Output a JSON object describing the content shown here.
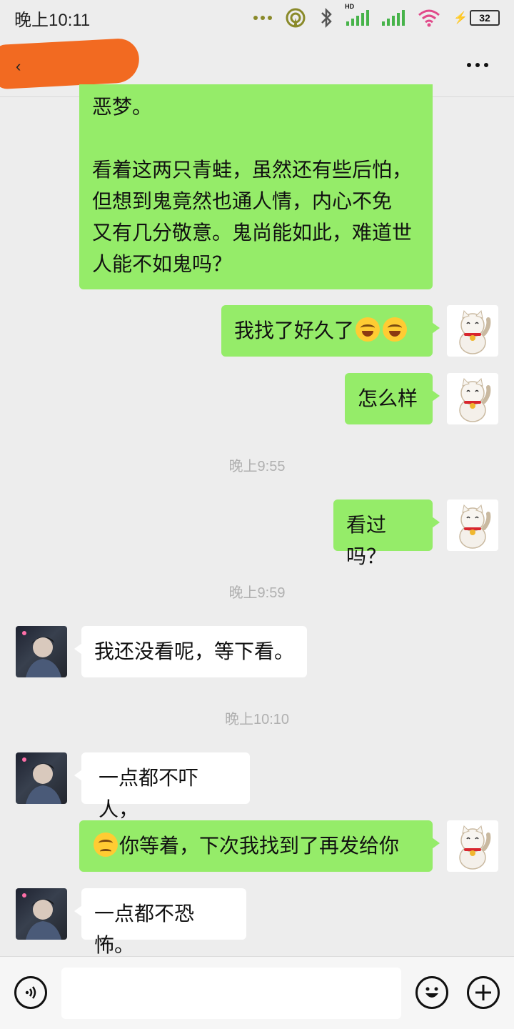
{
  "status_bar": {
    "time": "晚上10:11",
    "battery": "32",
    "hd_label": "HD"
  },
  "header": {
    "back_glyph": "‹",
    "more_icon": "more-dots-icon"
  },
  "messages": {
    "m1_lines": [
      "恶梦。",
      "",
      "看着这两只青蛙，虽然还有些后怕，",
      "但想到鬼竟然也通人情，内心不免",
      "又有几分敬意。鬼尚能如此，难道世",
      "人能不如鬼吗？"
    ],
    "m2": "我找了好久了",
    "m3": "怎么样",
    "ts1": "晚上9:55",
    "m4": "看过吗？",
    "ts2": "晚上9:59",
    "m5": "我还没看呢，等下看。",
    "ts3": "晚上10:10",
    "m6": "一点都不吓人，",
    "m7": "你等着，下次我找到了再发给你",
    "m8": "一点都不恐怖。"
  },
  "input_bar": {
    "voice_icon": "voice-icon",
    "emoji_icon": "emoji-icon",
    "plus_icon": "plus-icon",
    "input_value": ""
  },
  "colors": {
    "my_bubble": "#95ec69",
    "other_bubble": "#ffffff",
    "background": "#ededed"
  }
}
